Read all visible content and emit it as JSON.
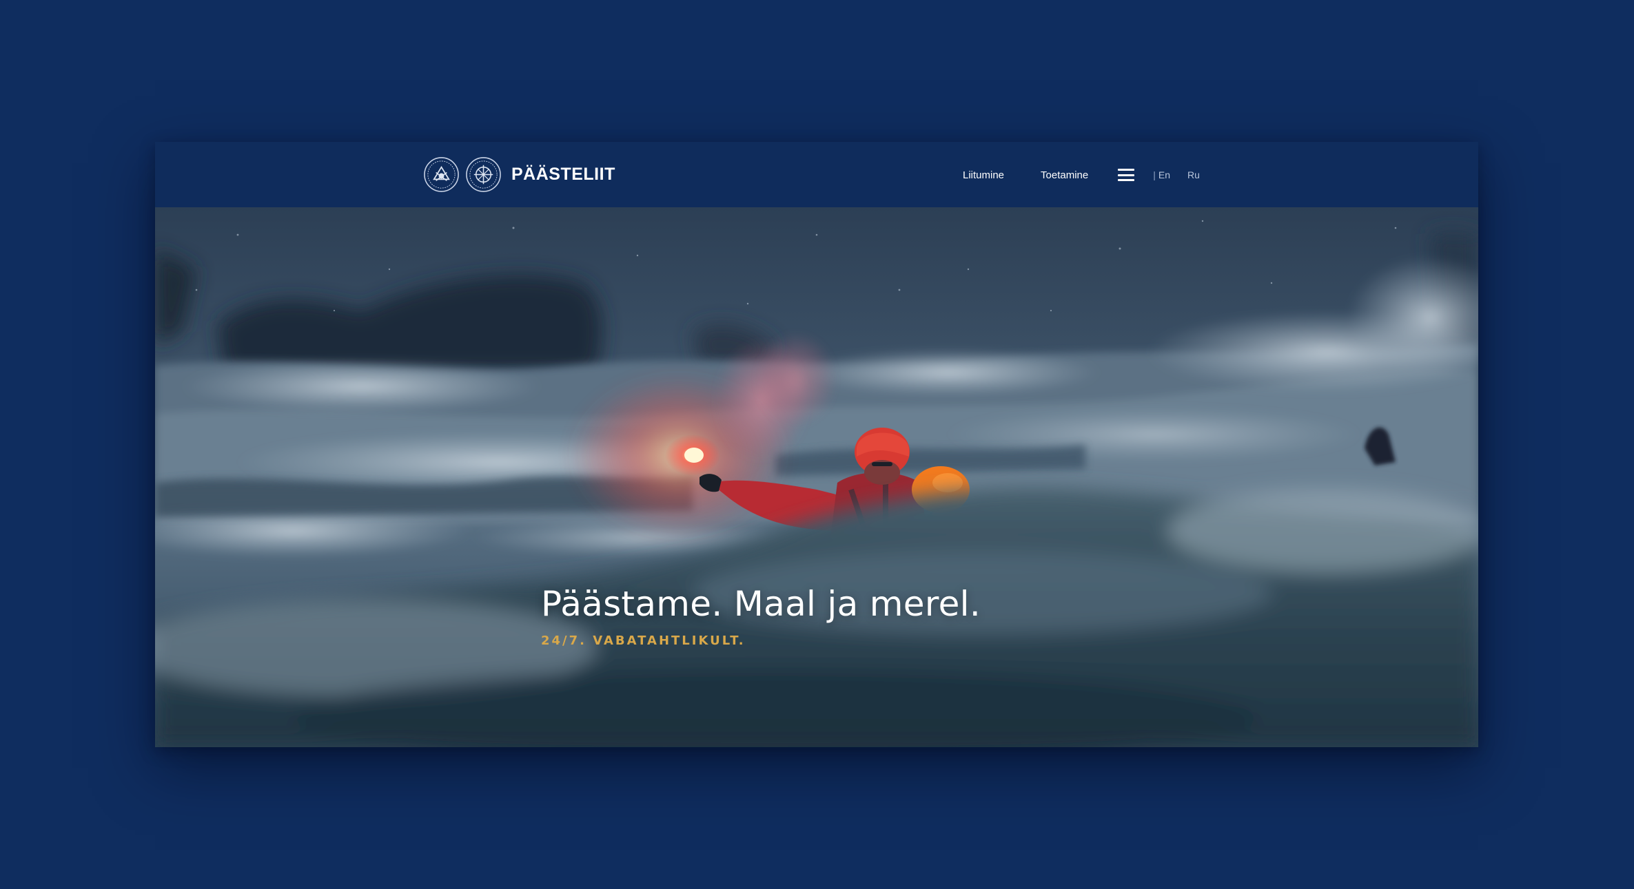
{
  "colors": {
    "background": "#0f2d5f",
    "header": "#0f2c5c",
    "accent": "#d9a84a",
    "text": "#ffffff"
  },
  "header": {
    "brand_name": "PÄÄSTELIIT",
    "emblems": [
      "emblem-icon",
      "emblem-icon"
    ],
    "nav": {
      "join_label": "Liitumine",
      "support_label": "Toetamine",
      "menu_icon": "hamburger-menu-icon"
    },
    "languages": {
      "separator": "|",
      "en": "En",
      "ru": "Ru"
    }
  },
  "hero": {
    "title": "Päästame. Maal ja merel.",
    "subtitle": "24/7. VABATAHTLIKULT.",
    "image": "rescuer-with-flare-in-stormy-sea"
  }
}
